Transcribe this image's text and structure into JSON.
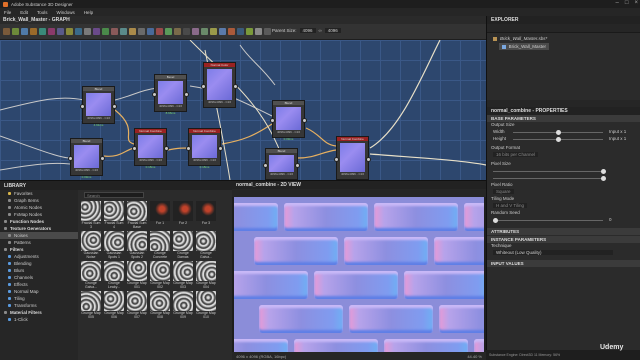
{
  "app": {
    "title": "Adobe Substance 3D Designer"
  },
  "menu": [
    "File",
    "Edit",
    "Tools",
    "Windows",
    "Help"
  ],
  "graph": {
    "tab_label": "Brick_Wall_Master - GRAPH",
    "parent_size_label": "Parent Size:",
    "parent_size_w": "4096",
    "parent_size_h": "4096",
    "nodes": [
      {
        "title": "Blend",
        "footer": "4096x4096 - C16",
        "subtitle": "4.91ms",
        "red": false
      },
      {
        "title": "Bevel",
        "footer": "4096x4096 - C16",
        "subtitle": "8.66ms",
        "red": false
      },
      {
        "title": "Normal Color",
        "footer": "4096x4096 - C16",
        "subtitle": "",
        "red": true
      },
      {
        "title": "Blend",
        "footer": "4096x4096 - C16",
        "subtitle": "0.09ms",
        "red": false
      },
      {
        "title": "Normal Combine",
        "footer": "4096x4096 - C16",
        "subtitle": "0.18ms",
        "red": true
      },
      {
        "title": "Normal Combine",
        "footer": "4096x4096 - C16",
        "subtitle": "0.18ms",
        "red": true
      },
      {
        "title": "Blend",
        "footer": "4096x4096 - C16",
        "subtitle": "0.09ms",
        "red": false
      },
      {
        "title": "Blend",
        "footer": "4096x4096 - C16",
        "subtitle": "",
        "red": false
      },
      {
        "title": "Normal Combine",
        "footer": "4096x4096 - C16",
        "subtitle": "0.18ms",
        "red": true
      }
    ]
  },
  "explorer": {
    "title": "EXPLORER",
    "package": "Brick_Wall_Master.sbs*",
    "graph_item": "Brick_Wall_Master"
  },
  "properties": {
    "title": "normal_combine - PROPERTIES",
    "base_header": "BASE PARAMETERS",
    "output_size_label": "Output Size",
    "width_label": "Width",
    "width_value": "Input x 1",
    "height_label": "Height",
    "height_value": "Input x 1",
    "output_format_label": "Output Format",
    "output_format_value": "16 bits per Channel",
    "pixel_size_label": "Pixel Size",
    "pixel_ratio_label": "Pixel Ratio",
    "pixel_ratio_value": "Square",
    "tiling_label": "Tiling Mode",
    "tiling_value": "H and V Tiling",
    "seed_label": "Random Seed",
    "seed_value": "0",
    "attributes_header": "ATTRIBUTES",
    "instance_header": "INSTANCE PARAMETERS",
    "technique_label": "Technique",
    "technique_value": "Whiteout (Low Quality)",
    "input_values_header": "INPUT VALUES"
  },
  "library": {
    "title": "LIBRARY",
    "search_placeholder": "Search",
    "sidebar": [
      {
        "label": "Favorites",
        "header": false,
        "color": "#d9b64a"
      },
      {
        "label": "Graph Items",
        "header": false,
        "color": "#8a8a8a"
      },
      {
        "label": "Atomic Nodes",
        "header": false,
        "color": "#8a8a8a"
      },
      {
        "label": "FxMap Nodes",
        "header": false,
        "color": "#8a8a8a"
      },
      {
        "label": "Function Nodes",
        "header": true,
        "color": "#8a8a8a"
      },
      {
        "label": "Texture Generators",
        "header": true,
        "color": "#8a8a8a"
      },
      {
        "label": "Noises",
        "header": false,
        "color": "#8a8a8a"
      },
      {
        "label": "Patterns",
        "header": false,
        "color": "#8a8a8a"
      },
      {
        "label": "Filters",
        "header": true,
        "color": "#8a8a8a"
      },
      {
        "label": "Adjustments",
        "header": false,
        "color": "#5a9be0"
      },
      {
        "label": "Blending",
        "header": false,
        "color": "#5a9be0"
      },
      {
        "label": "Blurs",
        "header": false,
        "color": "#5a9be0"
      },
      {
        "label": "Channels",
        "header": false,
        "color": "#5a9be0"
      },
      {
        "label": "Effects",
        "header": false,
        "color": "#5a9be0"
      },
      {
        "label": "Normal Map",
        "header": false,
        "color": "#5a9be0"
      },
      {
        "label": "Tiling",
        "header": false,
        "color": "#5a9be0"
      },
      {
        "label": "Transforms",
        "header": false,
        "color": "#5a9be0"
      },
      {
        "label": "Material Filters",
        "header": true,
        "color": "#8a8a8a"
      },
      {
        "label": "1-Click",
        "header": false,
        "color": "#5a9be0"
      }
    ],
    "thumbs": [
      {
        "label": "Fractal Sum 3",
        "tone": "noise"
      },
      {
        "label": "Fractal Sum 4",
        "tone": "noise"
      },
      {
        "label": "Fractal Sum Base",
        "tone": "noise"
      },
      {
        "label": "Fur 1",
        "tone": "dark"
      },
      {
        "label": "Fur 2",
        "tone": "dark"
      },
      {
        "label": "Fur 3",
        "tone": "dark"
      },
      {
        "label": "Gaussian Noise",
        "tone": "noise"
      },
      {
        "label": "Gaussian Spots 1",
        "tone": "noise"
      },
      {
        "label": "Gaussian Spots 2",
        "tone": "noise"
      },
      {
        "label": "Grunge Concrete",
        "tone": "noise"
      },
      {
        "label": "Grunge Damas",
        "tone": "noise"
      },
      {
        "label": "Grunge Galva...",
        "tone": "noise"
      },
      {
        "label": "Grunge Galva...",
        "tone": "noise"
      },
      {
        "label": "Grunge Leaky...",
        "tone": "noise"
      },
      {
        "label": "Grunge Map 001",
        "tone": "noise"
      },
      {
        "label": "Grunge Map 002",
        "tone": "noise"
      },
      {
        "label": "Grunge Map 003",
        "tone": "noise"
      },
      {
        "label": "Grunge Map 004",
        "tone": "noise"
      },
      {
        "label": "Grunge Map 005",
        "tone": "noise"
      },
      {
        "label": "Grunge Map 006",
        "tone": "noise"
      },
      {
        "label": "Grunge Map 007",
        "tone": "noise"
      },
      {
        "label": "Grunge Map 008",
        "tone": "noise"
      },
      {
        "label": "Grunge Map 009",
        "tone": "noise"
      },
      {
        "label": "Grunge Map 010",
        "tone": "noise"
      }
    ]
  },
  "view2d": {
    "title": "normal_combine - 2D VIEW",
    "status": "4096 x 4096 (RGBA, 16bpc)",
    "zoom": "44.40 %",
    "footer": "Substance Engine: Direct3D 11   Memory: 56%"
  },
  "watermark": "Udemy"
}
